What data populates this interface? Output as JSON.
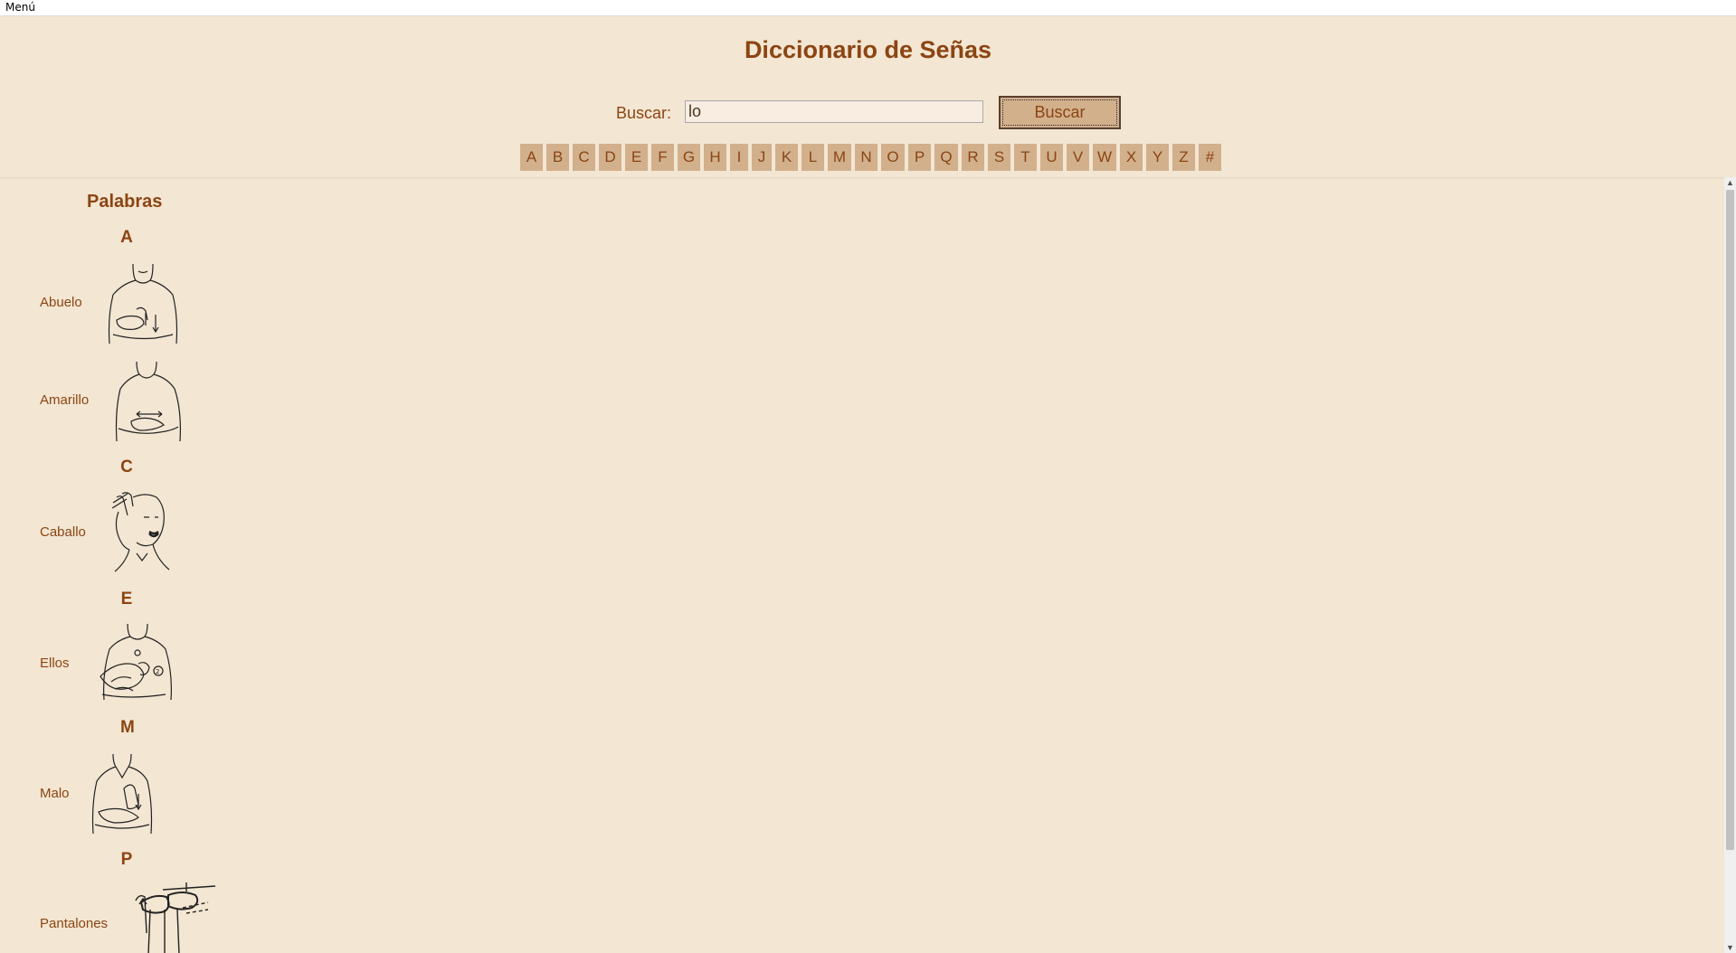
{
  "menubar": {
    "menu_label": "Menú"
  },
  "header": {
    "title": "Diccionario de Señas"
  },
  "search": {
    "label": "Buscar:",
    "value": "lo",
    "button_label": "Buscar"
  },
  "alphabet": [
    "A",
    "B",
    "C",
    "D",
    "E",
    "F",
    "G",
    "H",
    "I",
    "J",
    "K",
    "L",
    "M",
    "N",
    "O",
    "P",
    "Q",
    "R",
    "S",
    "T",
    "U",
    "V",
    "W",
    "X",
    "Y",
    "Z",
    "#"
  ],
  "results": {
    "heading": "Palabras",
    "groups": [
      {
        "letter": "A",
        "words": [
          "Abuelo",
          "Amarillo"
        ]
      },
      {
        "letter": "C",
        "words": [
          "Caballo"
        ]
      },
      {
        "letter": "E",
        "words": [
          "Ellos"
        ]
      },
      {
        "letter": "M",
        "words": [
          "Malo"
        ]
      },
      {
        "letter": "P",
        "words": [
          "Pantalones"
        ]
      }
    ]
  },
  "colors": {
    "background": "#f3e6d2",
    "text": "#8b4513",
    "button": "#d2b08c"
  }
}
